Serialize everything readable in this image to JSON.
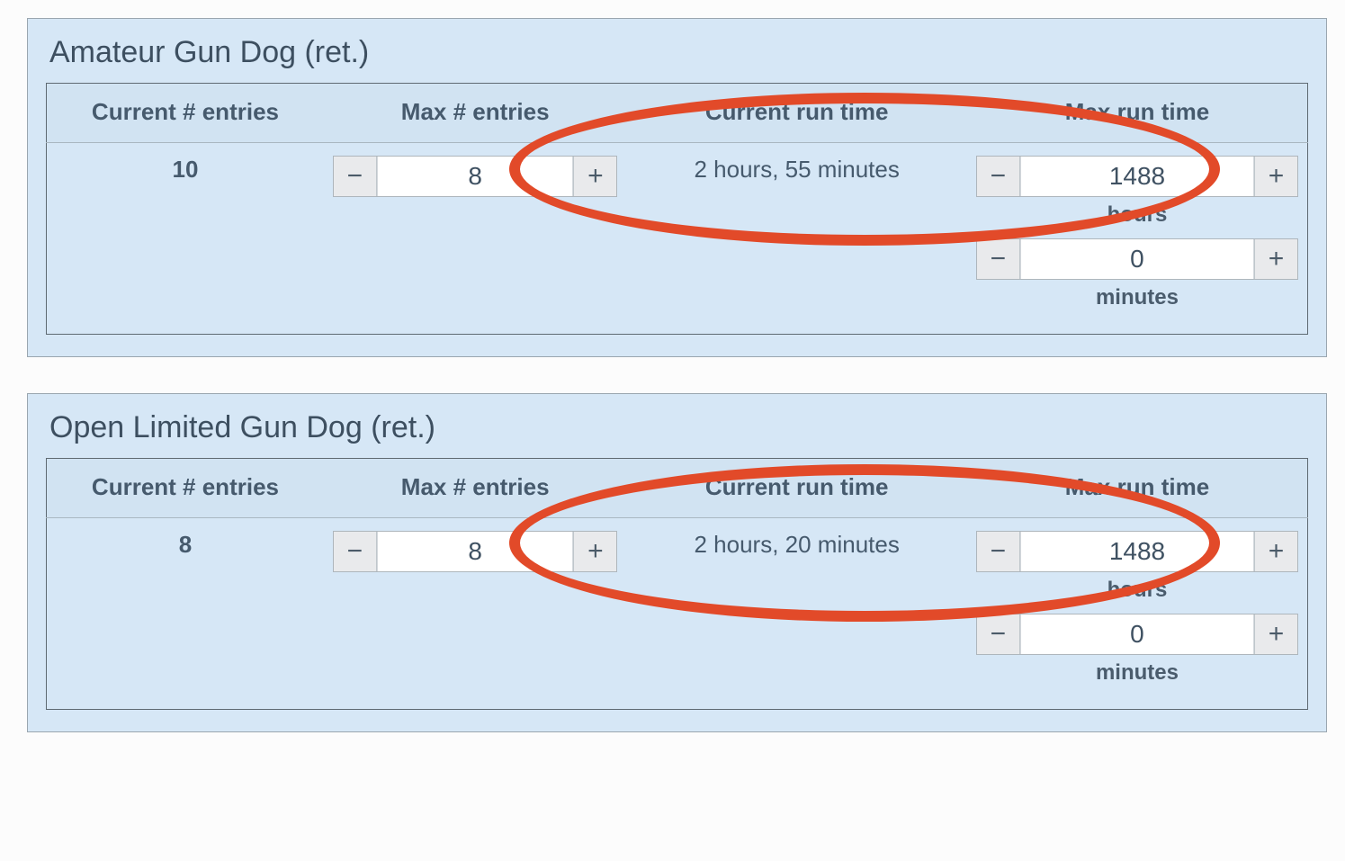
{
  "headers": {
    "current_entries": "Current # entries",
    "max_entries": "Max # entries",
    "current_runtime": "Current run time",
    "max_runtime": "Max run time"
  },
  "units": {
    "hours": "hours",
    "minutes": "minutes"
  },
  "glyphs": {
    "minus": "−",
    "plus": "+"
  },
  "panels": [
    {
      "title": "Amateur Gun Dog (ret.)",
      "current_entries": "10",
      "max_entries": "8",
      "current_runtime": "2 hours, 55 minutes",
      "max_runtime_hours": "1488",
      "max_runtime_minutes": "0"
    },
    {
      "title": "Open Limited Gun Dog (ret.)",
      "current_entries": "8",
      "max_entries": "8",
      "current_runtime": "2 hours, 20 minutes",
      "max_runtime_hours": "1488",
      "max_runtime_minutes": "0"
    }
  ]
}
